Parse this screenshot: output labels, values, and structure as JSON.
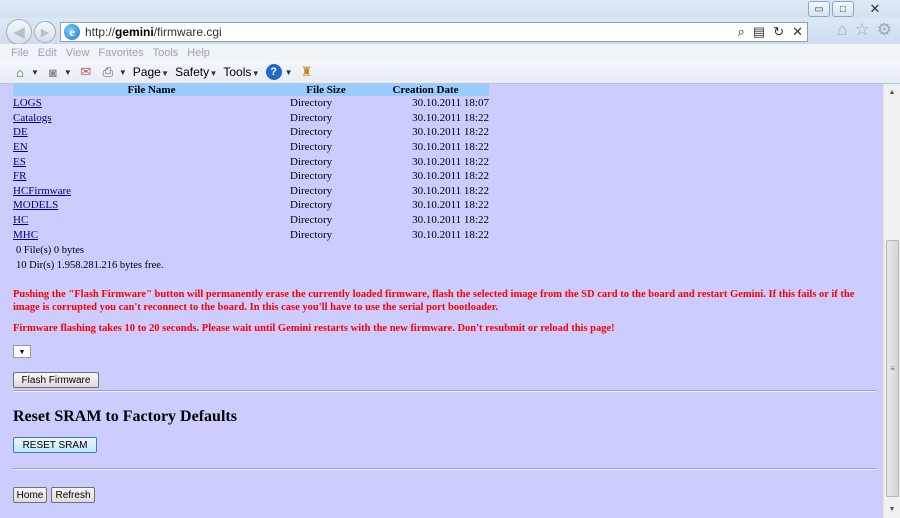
{
  "browser": {
    "url_prefix": "http://",
    "url_host": "gemini",
    "url_path": "/firmware.cgi",
    "window_buttons": {
      "minimize": "▭",
      "maximize": "□",
      "close": "✕"
    },
    "menu": [
      "File",
      "Edit",
      "View",
      "Favorites",
      "Tools",
      "Help"
    ],
    "command_bar": {
      "page": "Page",
      "safety": "Safety",
      "tools": "Tools"
    }
  },
  "table": {
    "headers": [
      "File Name",
      "File Size",
      "Creation Date"
    ],
    "rows": [
      {
        "name": "LOGS",
        "size": "Directory",
        "date": "30.10.2011 18:07"
      },
      {
        "name": "Catalogs",
        "size": "Directory",
        "date": "30.10.2011 18:22"
      },
      {
        "name": "DE",
        "size": "Directory",
        "date": "30.10.2011 18:22"
      },
      {
        "name": "EN",
        "size": "Directory",
        "date": "30.10.2011 18:22"
      },
      {
        "name": "ES",
        "size": "Directory",
        "date": "30.10.2011 18:22"
      },
      {
        "name": "FR",
        "size": "Directory",
        "date": "30.10.2011 18:22"
      },
      {
        "name": "HCFirmware",
        "size": "Directory",
        "date": "30.10.2011 18:22"
      },
      {
        "name": "MODELS",
        "size": "Directory",
        "date": "30.10.2011 18:22"
      },
      {
        "name": "HC",
        "size": "Directory",
        "date": "30.10.2011 18:22"
      },
      {
        "name": "MHC",
        "size": "Directory",
        "date": "30.10.2011 18:22"
      }
    ]
  },
  "summary": {
    "files": "0 File(s) 0 bytes",
    "dirs": "10 Dir(s) 1.958.281.216 bytes free."
  },
  "warnings": {
    "flash": "Pushing the \"Flash Firmware\" button will permanently erase the currently loaded firmware, flash the selected image from the SD card to the board and restart Gemini. If this fails or if the image is corrupted you can't reconnect to the board. In this case you'll have to use the serial port bootloader.",
    "timing": "Firmware flashing takes 10 to 20 seconds. Please wait until Gemini restarts with the new firmware. Don't resubmit or reload this page!"
  },
  "firmware": {
    "select_value": "",
    "flash_button": "Flash Firmware"
  },
  "sram": {
    "heading": "Reset SRAM to Factory Defaults",
    "reset_button": "RESET SRAM"
  },
  "footer": {
    "home": "Home",
    "refresh": "Refresh"
  }
}
